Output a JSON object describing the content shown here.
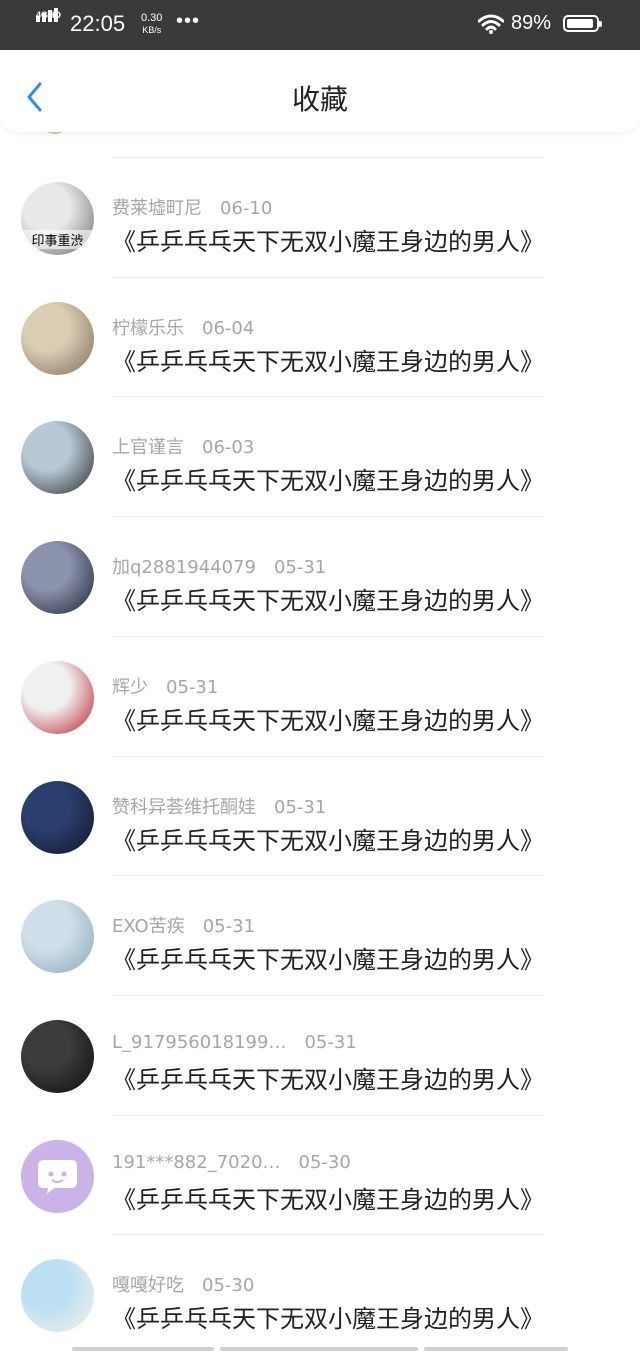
{
  "status_bar": {
    "network": "4GHD",
    "time": "22:05",
    "speed_value": "0.30",
    "speed_unit": "KB/s",
    "dots": "•••",
    "battery": "89%"
  },
  "header": {
    "title": "收藏",
    "back_icon": "chevron-left-icon",
    "accent": "#2f8cf0"
  },
  "items": [
    {
      "name": "费莱墟町尼",
      "date": "06-10",
      "text": "《乒乒乓乓天下无双小魔王身边的男人》",
      "avatar_overlay": "印事重渋",
      "avatar_colors": [
        "#e9e9e9",
        "#6a6a6a"
      ]
    },
    {
      "name": "柠檬乐乐",
      "date": "06-04",
      "text": "《乒乒乓乓天下无双小魔王身边的男人》",
      "avatar_colors": [
        "#d9cdb4",
        "#7d6c55"
      ]
    },
    {
      "name": "上官谨言",
      "date": "06-03",
      "text": "《乒乒乓乓天下无双小魔王身边的男人》",
      "avatar_colors": [
        "#b7c9d4",
        "#2c2c2c"
      ]
    },
    {
      "name": "加q2881944079",
      "date": "05-31",
      "text": "《乒乒乓乓天下无双小魔王身边的男人》",
      "avatar_colors": [
        "#8b93ad",
        "#1f2433"
      ]
    },
    {
      "name": "辉少",
      "date": "05-31",
      "text": "《乒乒乓乓天下无双小魔王身边的男人》",
      "avatar_colors": [
        "#f0f0f0",
        "#b81d2b"
      ]
    },
    {
      "name": "赞科异荟维托酮娃",
      "date": "05-31",
      "text": "《乒乒乓乓天下无双小魔王身边的男人》",
      "avatar_colors": [
        "#2b3f6e",
        "#0f1526"
      ]
    },
    {
      "name": "EXO苦疾",
      "date": "05-31",
      "text": "《乒乒乓乓天下无双小魔王身边的男人》",
      "avatar_colors": [
        "#cfe0ea",
        "#8aa6b9"
      ]
    },
    {
      "name": "L_917956018199…",
      "date": "05-31",
      "text": "《乒乒乓乓天下无双小魔王身边的男人》",
      "avatar_colors": [
        "#3c3c3c",
        "#0d0d0d"
      ]
    },
    {
      "name": "191***882_7020…",
      "date": "05-30",
      "text": "《乒乒乓乓天下无双小魔王身边的男人》",
      "avatar_colors": [
        "#cbb3e8",
        "#ffffff"
      ]
    },
    {
      "name": "嘎嘎好吃",
      "date": "05-30",
      "text": "《乒乒乓乓天下无双小魔王身边的男人》",
      "avatar_colors": [
        "#bcdff3",
        "#f4f1ea"
      ]
    }
  ]
}
